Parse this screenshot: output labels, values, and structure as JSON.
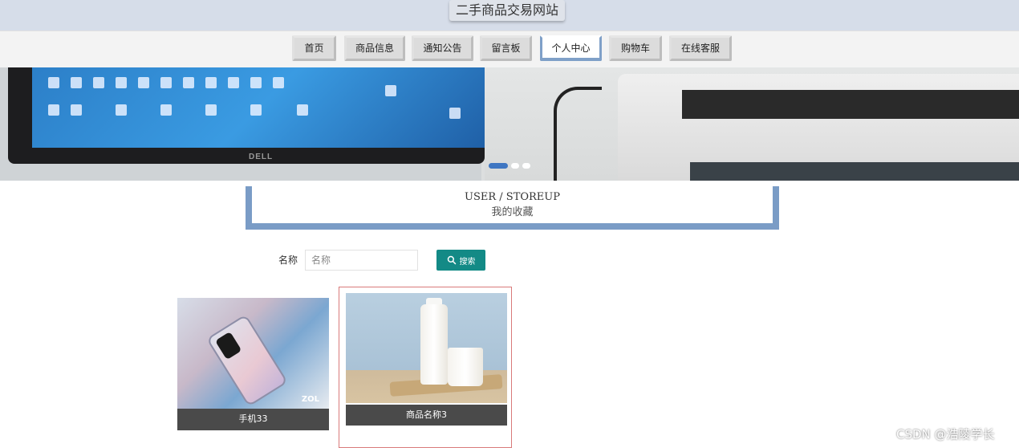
{
  "header": {
    "site_title": "二手商品交易网站"
  },
  "nav": {
    "items": [
      {
        "label": "首页",
        "active": false
      },
      {
        "label": "商品信息",
        "active": false
      },
      {
        "label": "通知公告",
        "active": false
      },
      {
        "label": "留言板",
        "active": false
      },
      {
        "label": "个人中心",
        "active": true
      },
      {
        "label": "购物车",
        "active": false
      },
      {
        "label": "在线客服",
        "active": false
      }
    ]
  },
  "banner": {
    "monitor_brand": "DELL",
    "slide_count": 3,
    "active_slide": 1
  },
  "section": {
    "title_en": "USER / STOREUP",
    "title_cn": "我的收藏"
  },
  "search": {
    "label": "名称",
    "placeholder": "名称",
    "value": "",
    "button_label": "搜索"
  },
  "products": [
    {
      "name": "手机33",
      "image_brand": "ZOL"
    },
    {
      "name": "商品名称3"
    }
  ],
  "colors": {
    "accent_blue": "#7a9cc6",
    "search_button": "#138a86",
    "caption_bg": "#4a4a4a",
    "highlight_border": "#d97a7a"
  },
  "watermark": "CSDN @浩陵学长"
}
